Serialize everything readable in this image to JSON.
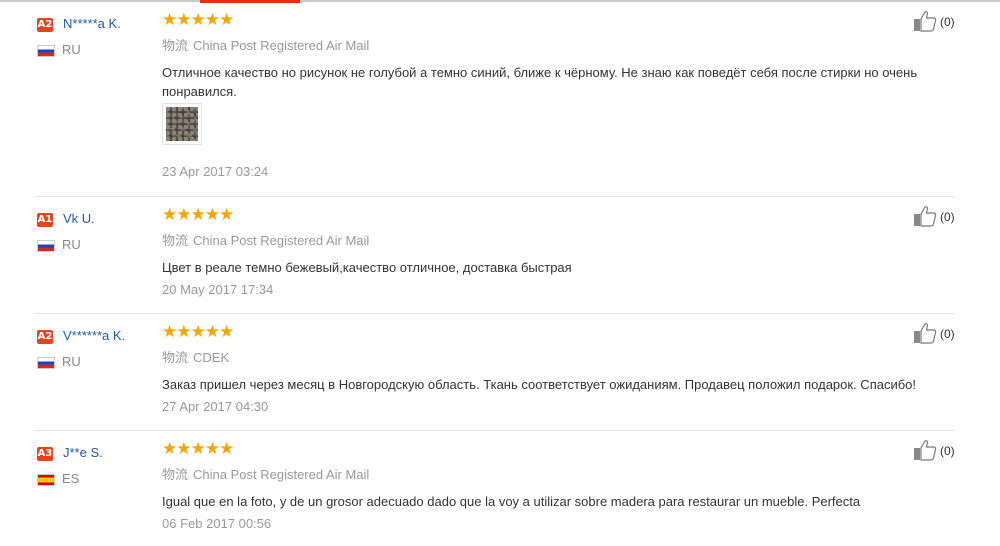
{
  "shipping_label": "物流",
  "reviews": [
    {
      "level": "A2",
      "name": "N*****a K.",
      "country": "RU",
      "flag": "russia-flag-icon",
      "stars": 5,
      "shipping": "China Post Registered Air Mail",
      "text": "Отличное качество но рисунок не голубой а темно синий, ближе к чёрному. Не знаю как поведёт себя после стирки но очень понравился.",
      "has_photo": true,
      "date": "23 Apr 2017 03:24",
      "likes": "(0)"
    },
    {
      "level": "A1",
      "name": "Vk U.",
      "country": "RU",
      "flag": "russia-flag-icon",
      "stars": 5,
      "shipping": "China Post Registered Air Mail",
      "text": "Цвет в реале темно бежевый,качество отличное, доставка быстрая",
      "has_photo": false,
      "date": "20 May 2017 17:34",
      "likes": "(0)"
    },
    {
      "level": "A2",
      "name": "V******a K.",
      "country": "RU",
      "flag": "russia-flag-icon",
      "stars": 5,
      "shipping": "CDEK",
      "text": "Заказ пришел через месяц в Новгородскую область. Ткань соответствует ожиданиям. Продавец положил подарок. Спасибо!",
      "has_photo": false,
      "date": "27 Apr 2017 04:30",
      "likes": "(0)"
    },
    {
      "level": "A3",
      "name": "J**e S.",
      "country": "ES",
      "flag": "spain-flag-icon",
      "stars": 5,
      "shipping": "China Post Registered Air Mail",
      "text": "Igual que en la foto, y de un grosor adecuado dado que la voy a utilizar sobre madera para restaurar un mueble. Perfecta",
      "has_photo": false,
      "date": "06 Feb 2017 00:56",
      "likes": "(0)"
    }
  ],
  "colors": {
    "accent": "#e62e04",
    "badge": "#e2461a",
    "star": "#f6a500",
    "name_link": "#1e5aa8"
  }
}
